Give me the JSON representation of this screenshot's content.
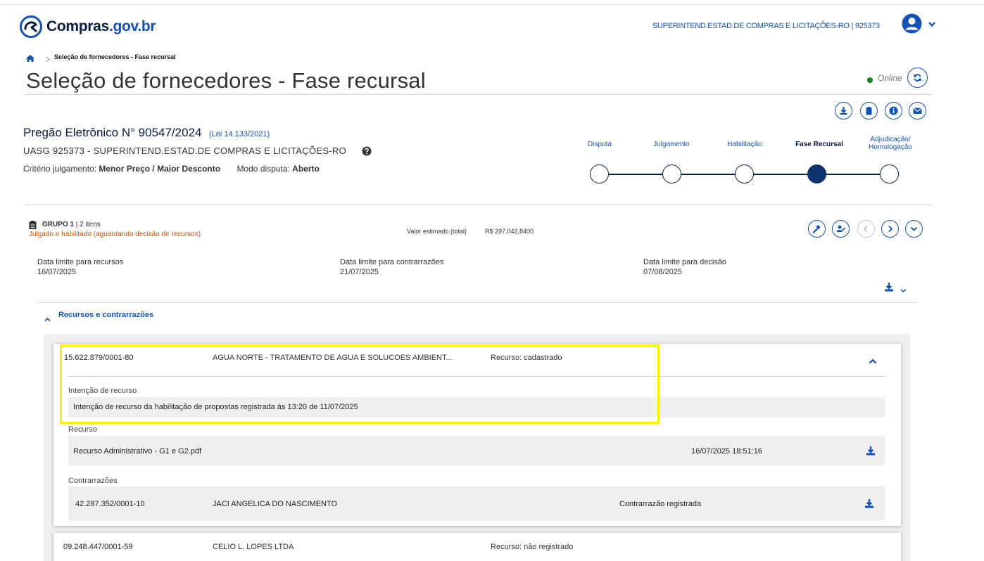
{
  "header": {
    "logo_main": "Compras",
    "logo_suffix": ".gov.br",
    "org_link": "SUPERINTEND.ESTAD.DE COMPRAS E LICITAÇÕES-RO | 925373"
  },
  "breadcrumb": {
    "current": "Seleção de fornecedores - Fase recursal"
  },
  "page": {
    "title": "Seleção de fornecedores - Fase recursal",
    "status": "Online"
  },
  "pregao": {
    "title": "Pregão Eletrônico N° 90547/2024",
    "lei": "(Lei 14.133/2021)",
    "uasg": "UASG 925373 - SUPERINTEND.ESTAD.DE COMPRAS E LICITAÇÕES-RO",
    "criterio_label": "Critério julgamento:",
    "criterio_value": "Menor Preço / Maior Desconto",
    "modo_label": "Modo disputa:",
    "modo_value": "Aberto"
  },
  "stepper": {
    "steps": [
      {
        "label": "Disputa",
        "state": "done"
      },
      {
        "label": "Julgamento",
        "state": "done"
      },
      {
        "label": "Habilitação",
        "state": "done"
      },
      {
        "label": "Fase Recursal",
        "state": "active"
      },
      {
        "label": "Adjudicação/ Homologação",
        "state": "pending"
      }
    ]
  },
  "grupo": {
    "name": "GRUPO 1",
    "items": "| 2 itens",
    "status": "Julgado e habilitado (aguardando decisão de recursos)",
    "valor_label": "Valor estimado (total)",
    "valor_value": "R$ 297.042,8400"
  },
  "deadlines": {
    "recursos_label": "Data limite para recursos",
    "recursos_value": "16/07/2025",
    "contrarrazoes_label": "Data limite para contrarrazões",
    "contrarrazoes_value": "21/07/2025",
    "decisao_label": "Data limite para decisão",
    "decisao_value": "07/08/2025"
  },
  "recursos_section": {
    "title": "Recursos e contrarrazões"
  },
  "supplier1": {
    "cnpj": "15.622.879/0001-80",
    "name": "AGUA NORTE - TRATAMENTO DE AGUA E SOLUCOES AMBIENT...",
    "status": "Recurso: cadastrado",
    "intencao_label": "Intenção de recurso",
    "intencao_text": "Intenção de recurso da habilitação de propostas registrada às 13:20 de 11/07/2025",
    "recurso_label": "Recurso",
    "recurso_file": "Recurso Administrativo - G1 e G2.pdf",
    "recurso_date": "16/07/2025 18:51:16",
    "contrarrazoes_label": "Contrarrazões",
    "contra_cnpj": "42.287.352/0001-10",
    "contra_name": "JACI ANGELICA DO NASCIMENTO",
    "contra_status": "Contrarrazão registrada"
  },
  "supplier2": {
    "cnpj": "09.248.447/0001-59",
    "name": "CELIO L. LOPES LTDA",
    "status": "Recurso: não registrado"
  },
  "colors": {
    "primary_blue": "#1351b4",
    "navy": "#071d41",
    "status_orange": "#c94b00",
    "online_green": "#168821",
    "highlight_yellow": "#ffee00"
  }
}
